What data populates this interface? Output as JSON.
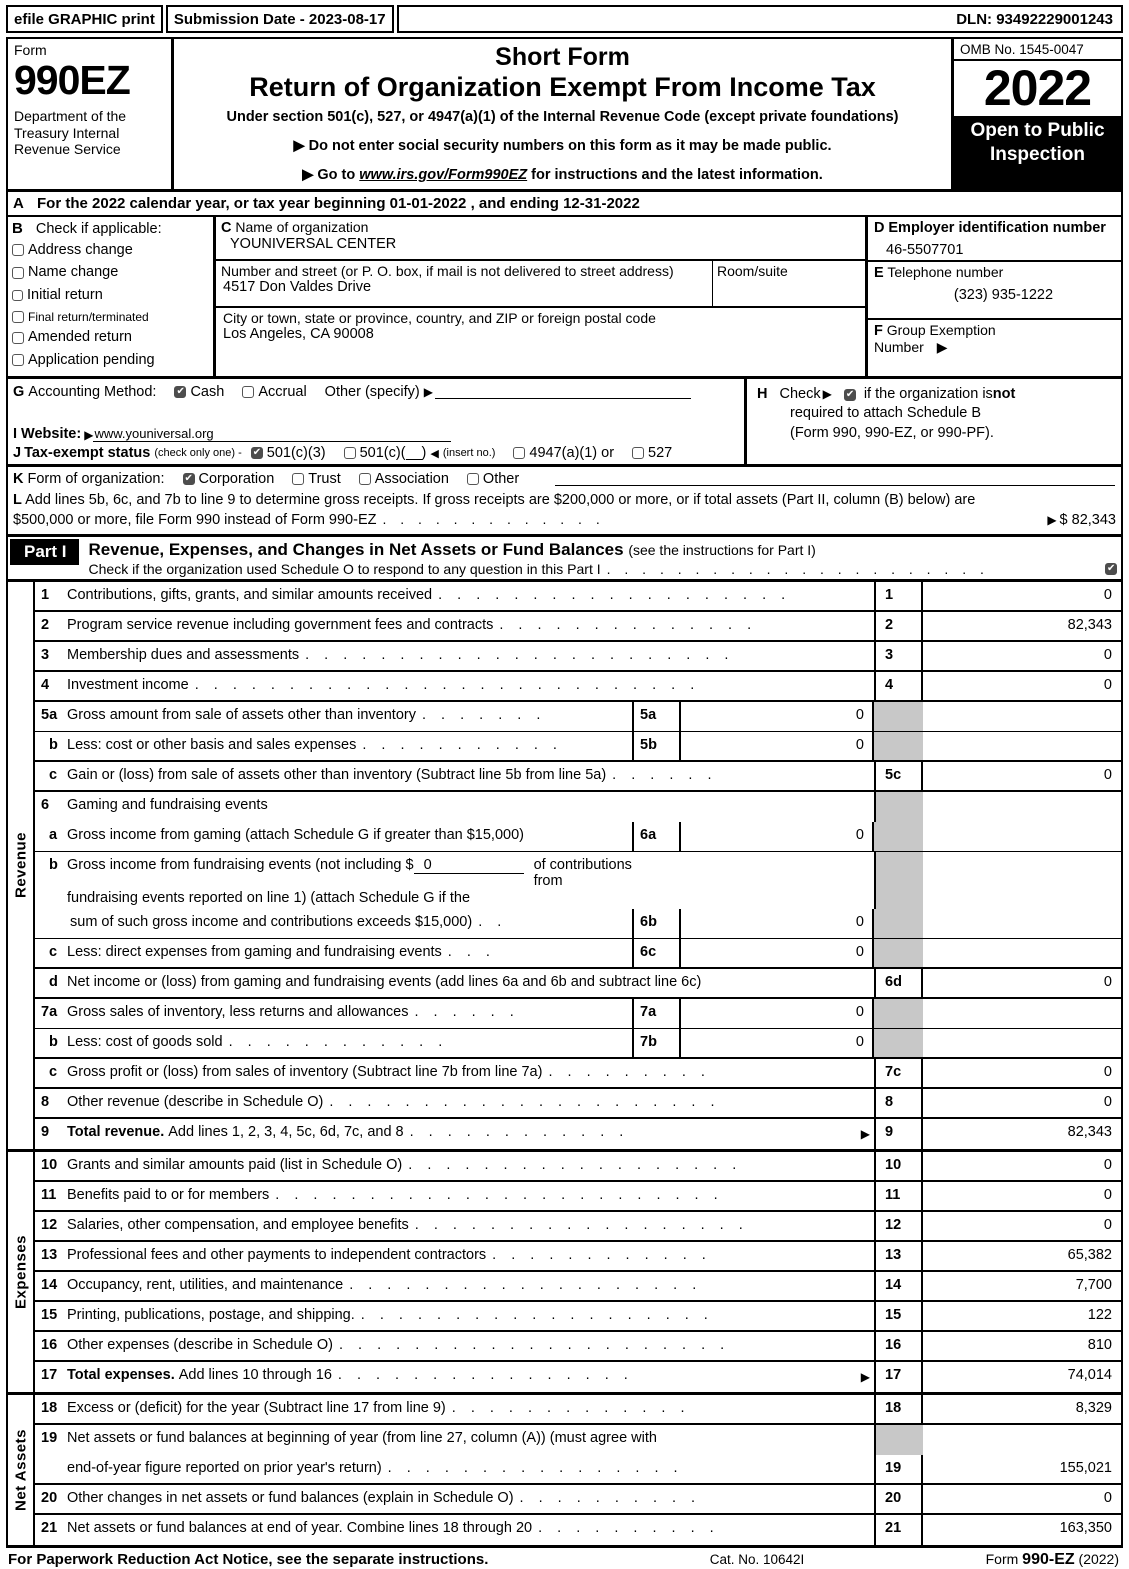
{
  "efile": {
    "print_label": "efile GRAPHIC print",
    "submission": "Submission Date - 2023-08-17",
    "dln": "DLN: 93492229001243"
  },
  "header": {
    "form_word": "Form",
    "form_number": "990EZ",
    "department": "Department of the Treasury Internal Revenue Service",
    "title_line1": "Short Form",
    "title_line2": "Return of Organization Exempt From Income Tax",
    "subtitle": "Under section 501(c), 527, or 4947(a)(1) of the Internal Revenue Code (except private foundations)",
    "notice1": "Do not enter social security numbers on this form as it may be made public.",
    "notice2_prefix": "Go to ",
    "notice2_link": "www.irs.gov/Form990EZ",
    "notice2_suffix": " for instructions and the latest information.",
    "omb": "OMB No. 1545-0047",
    "tax_year": "2022",
    "open_to_public": "Open to Public Inspection"
  },
  "lineA": {
    "letter": "A",
    "text_before": "For the 2022 calendar year, or tax year beginning",
    "begin_date": "01-01-2022",
    "text_mid": ", and ending",
    "end_date": "12-31-2022"
  },
  "sectionB": {
    "letter": "B",
    "heading": "Check if applicable:",
    "options": [
      {
        "label": "Address change",
        "checked": false
      },
      {
        "label": "Name change",
        "checked": false
      },
      {
        "label": "Initial return",
        "checked": false
      },
      {
        "label": "Final return/terminated",
        "checked": false
      },
      {
        "label": "Amended return",
        "checked": false
      },
      {
        "label": "Application pending",
        "checked": false
      }
    ]
  },
  "sectionC": {
    "letter": "C",
    "name_label": "Name of organization",
    "name_value": "YOUNIVERSAL CENTER",
    "street_label": "Number and street (or P. O. box, if mail is not delivered to street address)",
    "street_value": "4517 Don Valdes Drive",
    "room_label": "Room/suite",
    "room_value": "",
    "city_label": "City or town, state or province, country, and ZIP or foreign postal code",
    "city_value": "Los Angeles, CA   90008"
  },
  "sectionD": {
    "letter": "D",
    "label": "Employer identification number",
    "value": "46-5507701"
  },
  "sectionE": {
    "letter": "E",
    "label": "Telephone number",
    "value": "(323) 935-1222"
  },
  "sectionF": {
    "letter": "F",
    "label_line1": "Group Exemption",
    "label_line2": "Number",
    "value": ""
  },
  "sectionG": {
    "letter": "G",
    "label": "Accounting Method:",
    "cash_label": "Cash",
    "cash_checked": true,
    "accrual_label": "Accrual",
    "accrual_checked": false,
    "other_label": "Other (specify)",
    "other_value": ""
  },
  "sectionH": {
    "letter": "H",
    "check_label": "Check",
    "checked": true,
    "text1": "if the organization is ",
    "text1_bold": "not",
    "text2": "required to attach Schedule B",
    "text3": "(Form 990, 990-EZ, or 990-PF)."
  },
  "sectionI": {
    "letter": "I",
    "label": "Website:",
    "value": "www.youniversal.org"
  },
  "sectionJ": {
    "letter": "J",
    "label": "Tax-exempt status",
    "note": "(check only one) -",
    "opt1": "501(c)(3)",
    "opt1_checked": true,
    "opt2": "501(c)(",
    "opt2_checked": false,
    "opt2_suffix": ")",
    "insert_note": "(insert no.)",
    "opt3": "4947(a)(1) or",
    "opt3_checked": false,
    "opt4": "527",
    "opt4_checked": false
  },
  "sectionK": {
    "letter": "K",
    "label": "Form of organization:",
    "options": [
      {
        "label": "Corporation",
        "checked": true
      },
      {
        "label": "Trust",
        "checked": false
      },
      {
        "label": "Association",
        "checked": false
      },
      {
        "label": "Other",
        "checked": false
      }
    ]
  },
  "sectionL": {
    "letter": "L",
    "line1": "Add lines 5b, 6c, and 7b to line 9 to determine gross receipts. If gross receipts are $200,000 or more, or if total assets (Part II, column (B) below) are",
    "line2": "$500,000 or more, file Form 990 instead of Form 990-EZ",
    "amount": "$ 82,343"
  },
  "partI": {
    "label": "Part I",
    "title": "Revenue, Expenses, and Changes in Net Assets or Fund Balances",
    "title_note": "(see the instructions for Part I)",
    "schedule_o": "Check if the organization used Schedule O to respond to any question in this Part I",
    "schedule_o_checked": true
  },
  "side_labels": {
    "revenue": "Revenue",
    "expenses": "Expenses",
    "net_assets": "Net Assets"
  },
  "revenue_rows": [
    {
      "num": "1",
      "text": "Contributions, gifts, grants, and similar amounts received",
      "code": "1",
      "amount": "0"
    },
    {
      "num": "2",
      "text": "Program service revenue including government fees and contracts",
      "code": "2",
      "amount": "82,343"
    },
    {
      "num": "3",
      "text": "Membership dues and assessments",
      "code": "3",
      "amount": "0"
    },
    {
      "num": "4",
      "text": "Investment income",
      "code": "4",
      "amount": "0"
    },
    {
      "num": "5a",
      "text": "Gross amount from sale of assets other than inventory",
      "mid_code": "5a",
      "mid_amount": "0"
    },
    {
      "num": "b",
      "text": "Less: cost or other basis and sales expenses",
      "mid_code": "5b",
      "mid_amount": "0"
    },
    {
      "num": "c",
      "text": "Gain or (loss) from sale of assets other than inventory (Subtract line 5b from line 5a)",
      "code": "5c",
      "amount": "0"
    },
    {
      "num": "6",
      "text": "Gaming and fundraising events"
    },
    {
      "num": "a",
      "text": "Gross income from gaming (attach Schedule G if greater than $15,000)",
      "mid_code": "6a",
      "mid_amount": "0"
    },
    {
      "num": "b",
      "text": "Gross income from fundraising events (not including $",
      "inline_value": "0",
      "text_after": "of contributions from",
      "text_line2": "fundraising events reported on line 1) (attach Schedule G if the"
    },
    {
      "num": "",
      "text": "sum of such gross income and contributions exceeds $15,000)",
      "mid_code": "6b",
      "mid_amount": "0"
    },
    {
      "num": "c",
      "text": "Less: direct expenses from gaming and fundraising events",
      "mid_code": "6c",
      "mid_amount": "0"
    },
    {
      "num": "d",
      "text": "Net income or (loss) from gaming and fundraising events (add lines 6a and 6b and subtract line 6c)",
      "code": "6d",
      "amount": "0"
    },
    {
      "num": "7a",
      "text": "Gross sales of inventory, less returns and allowances",
      "mid_code": "7a",
      "mid_amount": "0"
    },
    {
      "num": "b",
      "text": "Less: cost of goods sold",
      "mid_code": "7b",
      "mid_amount": "0"
    },
    {
      "num": "c",
      "text": "Gross profit or (loss) from sales of inventory (Subtract line 7b from line 7a)",
      "code": "7c",
      "amount": "0"
    },
    {
      "num": "8",
      "text": "Other revenue (describe in Schedule O)",
      "code": "8",
      "amount": "0"
    },
    {
      "num": "9",
      "text_bold": "Total revenue.",
      "text": "Add lines 1, 2, 3, 4, 5c, 6d, 7c, and 8",
      "code": "9",
      "amount": "82,343"
    }
  ],
  "expense_rows": [
    {
      "num": "10",
      "text": "Grants and similar amounts paid (list in Schedule O)",
      "code": "10",
      "amount": "0"
    },
    {
      "num": "11",
      "text": "Benefits paid to or for members",
      "code": "11",
      "amount": "0"
    },
    {
      "num": "12",
      "text": "Salaries, other compensation, and employee benefits",
      "code": "12",
      "amount": "0"
    },
    {
      "num": "13",
      "text": "Professional fees and other payments to independent contractors",
      "code": "13",
      "amount": "65,382"
    },
    {
      "num": "14",
      "text": "Occupancy, rent, utilities, and maintenance",
      "code": "14",
      "amount": "7,700"
    },
    {
      "num": "15",
      "text": "Printing, publications, postage, and shipping.",
      "code": "15",
      "amount": "122"
    },
    {
      "num": "16",
      "text": "Other expenses (describe in Schedule O)",
      "code": "16",
      "amount": "810"
    },
    {
      "num": "17",
      "text_bold": "Total expenses.",
      "text": "Add lines 10 through 16",
      "code": "17",
      "amount": "74,014"
    }
  ],
  "netasset_rows": [
    {
      "num": "18",
      "text": "Excess or (deficit) for the year (Subtract line 17 from line 9)",
      "code": "18",
      "amount": "8,329"
    },
    {
      "num": "19",
      "text": "Net assets or fund balances at beginning of year (from line 27, column (A)) (must agree with"
    },
    {
      "num": "",
      "text": "end-of-year figure reported on prior year's return)",
      "code": "19",
      "amount": "155,021"
    },
    {
      "num": "20",
      "text": "Other changes in net assets or fund balances (explain in Schedule O)",
      "code": "20",
      "amount": "0"
    },
    {
      "num": "21",
      "text": "Net assets or fund balances at end of year. Combine lines 18 through 20",
      "code": "21",
      "amount": "163,350"
    }
  ],
  "footer": {
    "left": "For Paperwork Reduction Act Notice, see the separate instructions.",
    "cat": "Cat. No. 10642I",
    "form_prefix": "Form ",
    "form_name": "990-EZ",
    "form_year": "(2022)"
  }
}
